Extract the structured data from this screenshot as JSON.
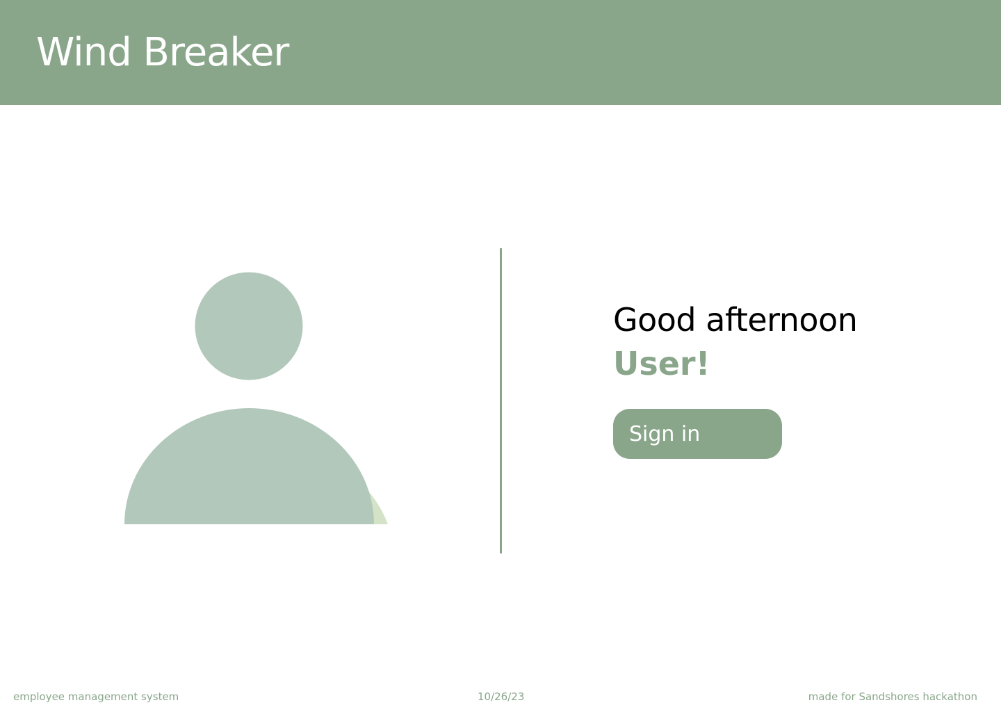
{
  "app": {
    "title": "Wind Breaker"
  },
  "welcome": {
    "greeting": "Good afternoon",
    "username": "User!",
    "sign_in_label": "Sign in"
  },
  "footer": {
    "left": "employee management system",
    "center": "10/26/23",
    "right": "made for Sandshores hackathon"
  },
  "icons": {
    "avatar": "user-avatar-icon"
  },
  "colors": {
    "accent": "#89a68a",
    "avatar": "#b2c8bb",
    "avatar_shadow": "#d4e3c8",
    "text": "#000000",
    "background": "#ffffff"
  }
}
